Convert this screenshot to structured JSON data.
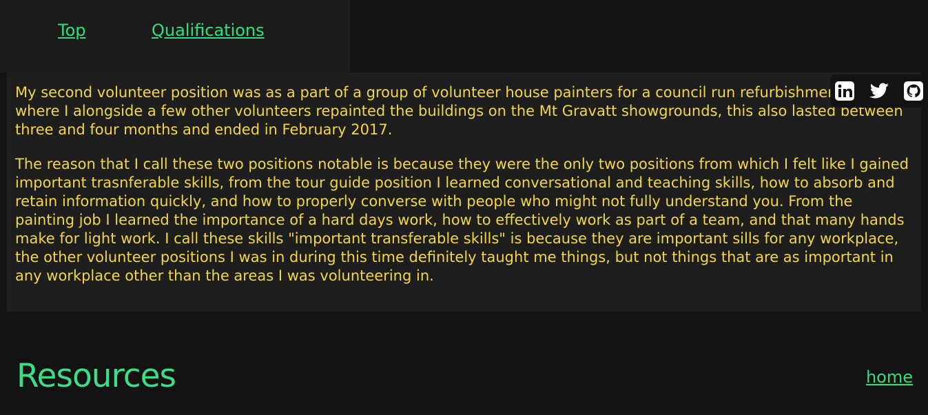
{
  "nav": {
    "top_label": "Top",
    "qualifications_label": "Qualifications"
  },
  "content": {
    "paragraphs": [
      "My second volunteer position was as a part of a group of volunteer house painters for a council run refurbishment program where I alongside a few other volunteers repainted the buildings on the Mt Gravatt showgrounds, this also lasted between three and four months and ended in February 2017.",
      "The reason that I call these two positions notable is because they were the only two positions from which I felt like I gained important trasnferable skills, from the tour guide position I learned conversational and teaching skills, how to absorb and retain information quickly, and how to properly converse with people who might not fully understand you. From the painting job I learned the importance of a hard days work, how to effectively work as part of a team, and that many hands make for light work. I call these skills \"important transferable skills\" is because they are important sills for any workplace, the other volunteer positions I was in during this time definitely taught me things, but not things that are as important in any workplace other than the areas I was volunteering in."
    ]
  },
  "social": {
    "icons": [
      "linkedin-icon",
      "twitter-icon",
      "github-icon"
    ]
  },
  "resources": {
    "title": "Resources",
    "home_label": "home"
  },
  "colors": {
    "background": "#131313",
    "panel": "#1e1e1e",
    "body_text": "#f3d646",
    "link": "#2fe07a",
    "heading": "#3ddc88"
  }
}
